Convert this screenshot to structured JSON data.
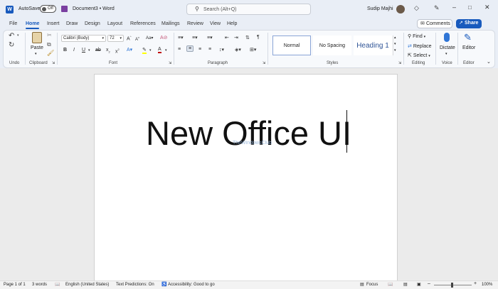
{
  "titlebar": {
    "autosave_label": "AutoSave",
    "autosave_state": "Off",
    "doc_title": "Document3",
    "separator": "•",
    "app_name": "Word",
    "search_placeholder": "Search (Alt+Q)",
    "user_name": "Sudip Majhi"
  },
  "tabs": [
    "File",
    "Home",
    "Insert",
    "Draw",
    "Design",
    "Layout",
    "References",
    "Mailings",
    "Review",
    "View",
    "Help"
  ],
  "ribbon": {
    "comments_label": "Comments",
    "share_label": "Share",
    "undo_group": "Undo",
    "clipboard": {
      "paste": "Paste",
      "group": "Clipboard"
    },
    "font": {
      "family": "Calibri (Body)",
      "size": "72",
      "group": "Font"
    },
    "paragraph_group": "Paragraph",
    "styles": {
      "items": [
        "Normal",
        "No Spacing",
        "Heading 1"
      ],
      "group": "Styles"
    },
    "editing": {
      "find": "Find",
      "replace": "Replace",
      "select": "Select",
      "group": "Editing"
    },
    "voice": {
      "dictate": "Dictate",
      "group": "Voice"
    },
    "editor": {
      "label": "Editor",
      "group": "Editor"
    }
  },
  "document": {
    "text": "New Office UI",
    "watermark": "TheWindowsClub"
  },
  "status": {
    "page": "Page 1 of 1",
    "words": "3 words",
    "language": "English (United States)",
    "predictions": "Text Predictions: On",
    "accessibility": "Accessibility: Good to go",
    "focus": "Focus",
    "zoom": "100%"
  },
  "colors": {
    "accent": "#185abd",
    "heading1": "#2f5496",
    "font_color_red": "#c00000",
    "highlight_yellow": "#ffff00"
  }
}
